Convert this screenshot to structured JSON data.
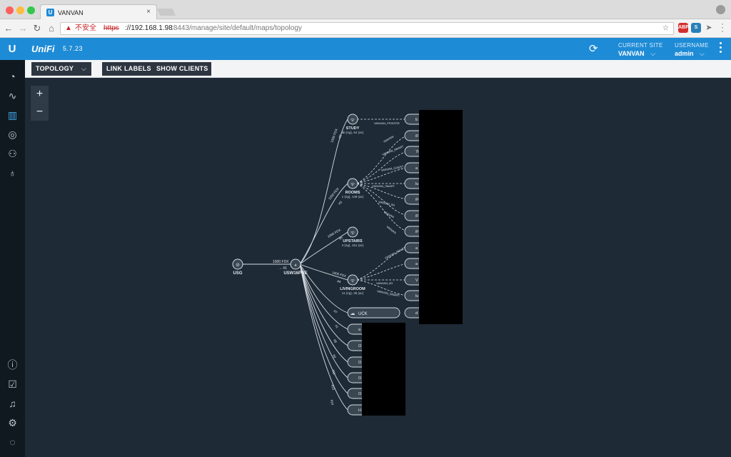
{
  "browser": {
    "tab_title": "VANVAN",
    "tab_close": "×",
    "nav_back": "←",
    "nav_forward": "→",
    "nav_reload": "↻",
    "nav_home": "⌂",
    "url_warning": "不安全",
    "url_scheme": "https",
    "url_host": "://192.168.1.98",
    "url_path": ":8443/manage/site/default/maps/topology",
    "ext_abp": "ABP"
  },
  "header": {
    "logo": "U",
    "app_name": "UniFi",
    "version": "5.7.23",
    "current_site_label": "CURRENT SITE",
    "current_site_value": "VANVAN",
    "username_label": "USERNAME",
    "username_value": "admin"
  },
  "toolbar": {
    "topology_label": "TOPOLOGY",
    "link_labels": "LINK LABELS",
    "show_clients": "SHOW CLIENTS"
  },
  "zoom": {
    "in": "+",
    "out": "−"
  },
  "sidebar": {
    "top_icons": [
      "dashboard-icon",
      "statistics-icon",
      "map-icon",
      "devices-icon",
      "clients-icon",
      "insights-icon"
    ],
    "bottom_icons": [
      "info-icon",
      "tasks-icon",
      "alerts-icon",
      "settings-icon",
      "chat-icon"
    ],
    "active": "map-icon"
  },
  "topology": {
    "gateway": {
      "name": "USG"
    },
    "switch": {
      "name": "USW16POE",
      "uplink_speed": "1000 FDX",
      "uplink_port": "→ #1"
    },
    "access_points": [
      {
        "name": "STUDY",
        "stats": "ab (ng), 64 (ac)",
        "link": "1000 FDX",
        "port": "#2"
      },
      {
        "name": "ROOMS",
        "stats": "1 (ng), 149 (ac)",
        "link": "1000 FDX",
        "port": "#3"
      },
      {
        "name": "UPSTAIRS",
        "stats": "4 (ng), 161 (ac)",
        "link": "1000 FDX",
        "port": "#5"
      },
      {
        "name": "LIVINGROOM",
        "stats": "11 (ng), 36 (ac)",
        "link": "1000 FDX",
        "port": "#4"
      }
    ],
    "ssids": [
      "VANVAN_PRINTER",
      "VANVAN",
      "VANVAN_SMART",
      "VANVAN_GUEST",
      "VANVAN_SMART",
      "VANVAN_5G",
      "VANVAN",
      "VANVAN",
      "VANVAN_SMART",
      "VANVAN_5G",
      "VANVAN_SMART"
    ],
    "uck": {
      "name": "UCK",
      "port": "#7"
    },
    "wired_ports": [
      "#1",
      "#8",
      "#9",
      "#11",
      "#13",
      "#14"
    ],
    "client_initials": [
      "E",
      "iF",
      "7t",
      "a",
      "lu",
      "iF",
      "iF",
      "iF",
      "a",
      "a",
      "V",
      "lu",
      "d",
      "a",
      "O",
      "O",
      "O",
      "O",
      "H"
    ]
  },
  "colors": {
    "header_blue": "#1e8bd6",
    "map_bg": "#1e2a36",
    "sidebar_bg": "#111920"
  }
}
